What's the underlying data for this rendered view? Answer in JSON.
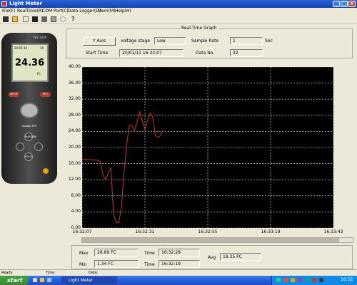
{
  "window": {
    "title": "Light Meter"
  },
  "menu": [
    "File(F)",
    "RealTime(R)",
    "COM Port(C)",
    "Data Logger(D)",
    "Mem(M)",
    "Help(H)"
  ],
  "toolbar_icons": [
    "save-icon",
    "folder-icon",
    "play-icon",
    "stop-icon",
    "disk-icon",
    "print-icon",
    "zoom-icon",
    "help-icon"
  ],
  "meter": {
    "brand": "TES-1339",
    "reading": "24.36",
    "unit": "FC",
    "time": "20:05:34",
    "count": "19",
    "btn_apo": "Disable APO",
    "btn_setup": "SETUP",
    "btn_rec": "REC",
    "btn_hold": "HOLD",
    "btn_max": "MAX/MIN"
  },
  "panel": {
    "group_title": "Real-Time   Graph",
    "y_axis_button": "Y Axis",
    "voltage_label": "voltage stage",
    "voltage_value": "Low",
    "sample_rate_label": "Sample Rate",
    "sample_rate_value": "1",
    "sample_rate_unit": "Sec",
    "start_time_label": "Start Time",
    "start_time_value": "20/01/11 16:32:07",
    "data_no_label": "Data No.",
    "data_no_value": "32"
  },
  "stats": {
    "max_label": "Max",
    "max_value": "28.89  FC",
    "max_time_label": "Time",
    "max_time": "16:32:28",
    "min_label": "Min",
    "min_value": "1.34  FC",
    "min_time_label": "Time",
    "min_time": "16:32:19",
    "avg_label": "Avg",
    "avg_value": "19.35  FC"
  },
  "status": {
    "ready": "Ready",
    "time": "Time:",
    "date": "Date:"
  },
  "taskbar": {
    "start": "start",
    "task": "Light Meter",
    "clock": "16:32"
  },
  "colors": {
    "plot_bg": "#000000",
    "line": "#c0392b",
    "grid": "#ffffff"
  },
  "chart_data": {
    "type": "line",
    "ylim": [
      0,
      40
    ],
    "yticks": [
      "0.00",
      "4.00",
      "8.00",
      "12.00",
      "16.00",
      "20.00",
      "24.00",
      "28.00",
      "32.00",
      "36.00",
      "40.00"
    ],
    "xticks": [
      "16:32:07",
      "16:32:31",
      "16:32:55",
      "16:33:19",
      "16:33:43"
    ],
    "grid": true,
    "series": [
      {
        "x_seconds": [
          0,
          1,
          2,
          3,
          4,
          5,
          6,
          7,
          8,
          9,
          10,
          11,
          12,
          13,
          14,
          15,
          16,
          17,
          18,
          19,
          20,
          21,
          22,
          23,
          24,
          25,
          26,
          27,
          28,
          29,
          30,
          31
        ],
        "values": [
          17.0,
          17.0,
          17.0,
          17.0,
          16.9,
          16.9,
          16.8,
          16.5,
          13.0,
          12.0,
          13.6,
          15.0,
          3.5,
          1.3,
          1.34,
          5.0,
          14.0,
          20.5,
          25.5,
          25.5,
          24.0,
          26.5,
          28.89,
          26.5,
          24.5,
          26.8,
          28.5,
          27.5,
          23.0,
          22.5,
          23.0,
          24.4
        ]
      }
    ]
  }
}
